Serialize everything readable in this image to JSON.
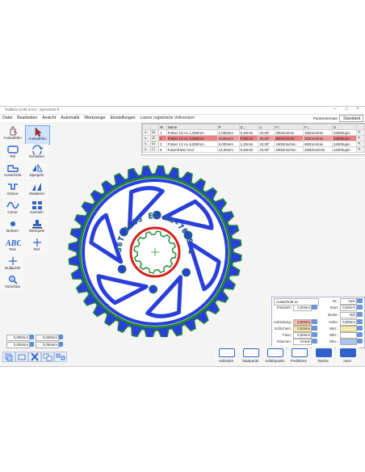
{
  "window": {
    "title": "Toolbox CAM 3.0.0 - Sprocket1.fr"
  },
  "menu": {
    "items": [
      "Datei",
      "Bearbeiten",
      "Ansicht",
      "Automatik",
      "Werkzeuge",
      "Einstellungen",
      "Lizenz registrierte Vollversion"
    ],
    "paramset_label": "Parametersatz:",
    "paramset_value": "Standard"
  },
  "toolbar": {
    "items": [
      {
        "label": "Auswählen",
        "icon": "hand-select-icon"
      },
      {
        "label": "Auswählen",
        "icon": "cursor-select-icon"
      },
      {
        "label": "Teil",
        "icon": "part-outline-icon"
      },
      {
        "label": "Schieben",
        "icon": "move-arrows-icon"
      },
      {
        "label": "Ausschnitt",
        "icon": "cutout-icon"
      },
      {
        "label": "Spiegeln",
        "icon": "mirror-icon"
      },
      {
        "label": "Gravur",
        "icon": "engrave-icon"
      },
      {
        "label": "Skalieren",
        "icon": "scale-icon"
      },
      {
        "label": "Carve",
        "icon": "carve-wave-icon"
      },
      {
        "label": "Kacheln",
        "icon": "tile-grid-icon"
      },
      {
        "label": "Bohren",
        "icon": "drill-dot-icon"
      },
      {
        "label": "Stempeln",
        "icon": "stamp-icon"
      },
      {
        "label": "Text",
        "icon": "text-abc-icon"
      },
      {
        "label": "Ref",
        "icon": "reference-cross-icon"
      },
      {
        "label": "Nullpunkt",
        "icon": "origin-cross-icon"
      },
      {
        "label": "Vorschau",
        "icon": "preview-magnifier-icon"
      }
    ]
  },
  "coords": {
    "row1": [
      "0,000mm",
      "0,000mm"
    ],
    "row2": [
      "0,000mm",
      "0,000mm"
    ]
  },
  "tool_table": {
    "headers": [
      "Nr",
      "Name",
      "⌀",
      "Z↔",
      "α",
      "F↕",
      "F↔",
      "S"
    ],
    "rows": [
      {
        "nr": "1",
        "name": "Fräser 1S AL 1,000mm",
        "d": "1,000mm",
        "z": "0,20mm",
        "a": "20,00°",
        "fz": "300mm/min",
        "fxy": "100mm/min",
        "s": "24000upm",
        "red": false
      },
      {
        "nr": "2",
        "name": "Fräser 1S AL 3,000mm",
        "d": "3,000mm",
        "z": "0,60mm",
        "a": "20,00°",
        "fz": "800mm/min",
        "fxy": "300mm/min",
        "s": "24000upm",
        "red": true
      },
      {
        "nr": "3",
        "name": "Fräser 1S AL 6,000mm",
        "d": "6,000mm",
        "z": "1,20mm",
        "a": "20,00°",
        "fz": "1600mm/min",
        "fxy": "600mm/min",
        "s": "24000upm",
        "red": false
      },
      {
        "nr": "5",
        "name": "Fasenfräser D12",
        "d": "12,00mm",
        "z": "0,50mm",
        "a": "20,00°",
        "fz": "2000mm/min",
        "fxy": "2000mm/min",
        "s": "24000upm",
        "red": false
      }
    ]
  },
  "sprocket": {
    "engraving": "36T 6L85 EN AW-7075 1651",
    "colors": {
      "outline": "#1e8a2e",
      "fill": "#2a3fd9",
      "bore": "#d62020",
      "dark": "#2a2a7a"
    }
  },
  "panel": {
    "title": "Ausschnitt 11",
    "fraestiefe_label": "Frästiefe:",
    "fraestiefe_value": "2,00mm",
    "anbindung_label": "Anbindung:",
    "anbindung_value": "3,00mm",
    "schlichten_label": "Schlichten:",
    "schlichten_value": "0,00mm",
    "fase_label": "Fase:",
    "fase_value": "0,00mm",
    "raeumen_label": "Räumen:",
    "raeumen_value": "Linear",
    "nr_label": "Nr.:",
    "nr_value": "Auto",
    "start_label": "Start:",
    "start_value": "0,00mm",
    "breite_label": "Breite:",
    "breite_value": "N/Z",
    "hoehe_label": "Höhe:",
    "hoehe_value": "0,00mm",
    "wkz1_label": "Wkz.:",
    "wkz2_label": "Wkz.:",
    "wkz3_label": "Wkz.:"
  },
  "bottom_buttons": [
    {
      "label": "Anbinden",
      "icon": "attach-icon"
    },
    {
      "label": "Startpunkt",
      "icon": "startpoint-icon"
    },
    {
      "label": "Anfahrpunkt",
      "icon": "approach-point-icon"
    },
    {
      "label": "Freifahren",
      "icon": "retract-icon"
    },
    {
      "label": "Tasche",
      "icon": "pocket-icon"
    },
    {
      "label": "Insel",
      "icon": "island-icon"
    }
  ]
}
